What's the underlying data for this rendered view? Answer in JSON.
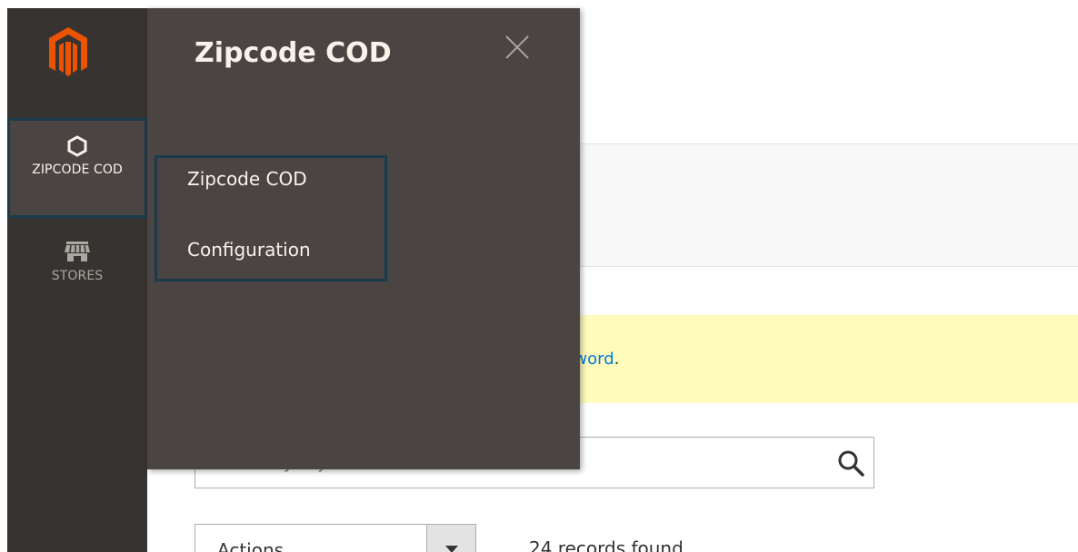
{
  "nav": {
    "items": [
      {
        "label": "ZIPCODE COD",
        "icon": "hexagon-icon",
        "active": true
      },
      {
        "label": "STORES",
        "icon": "store-icon",
        "active": false
      }
    ],
    "logo": "magento-logo",
    "colors": {
      "background": "#373330",
      "active_background": "#4a4542",
      "highlight_border": "#1b3a4b",
      "accent": "#eb5202"
    }
  },
  "flyout": {
    "title": "Zipcode COD",
    "items": [
      {
        "label": "Zipcode COD"
      },
      {
        "label": "Configuration"
      }
    ]
  },
  "main": {
    "notice_text": "sword",
    "notice_suffix": ".",
    "search_placeholder": "Search by keyword",
    "actions_label": "Actions",
    "records_found": "24 records found"
  }
}
